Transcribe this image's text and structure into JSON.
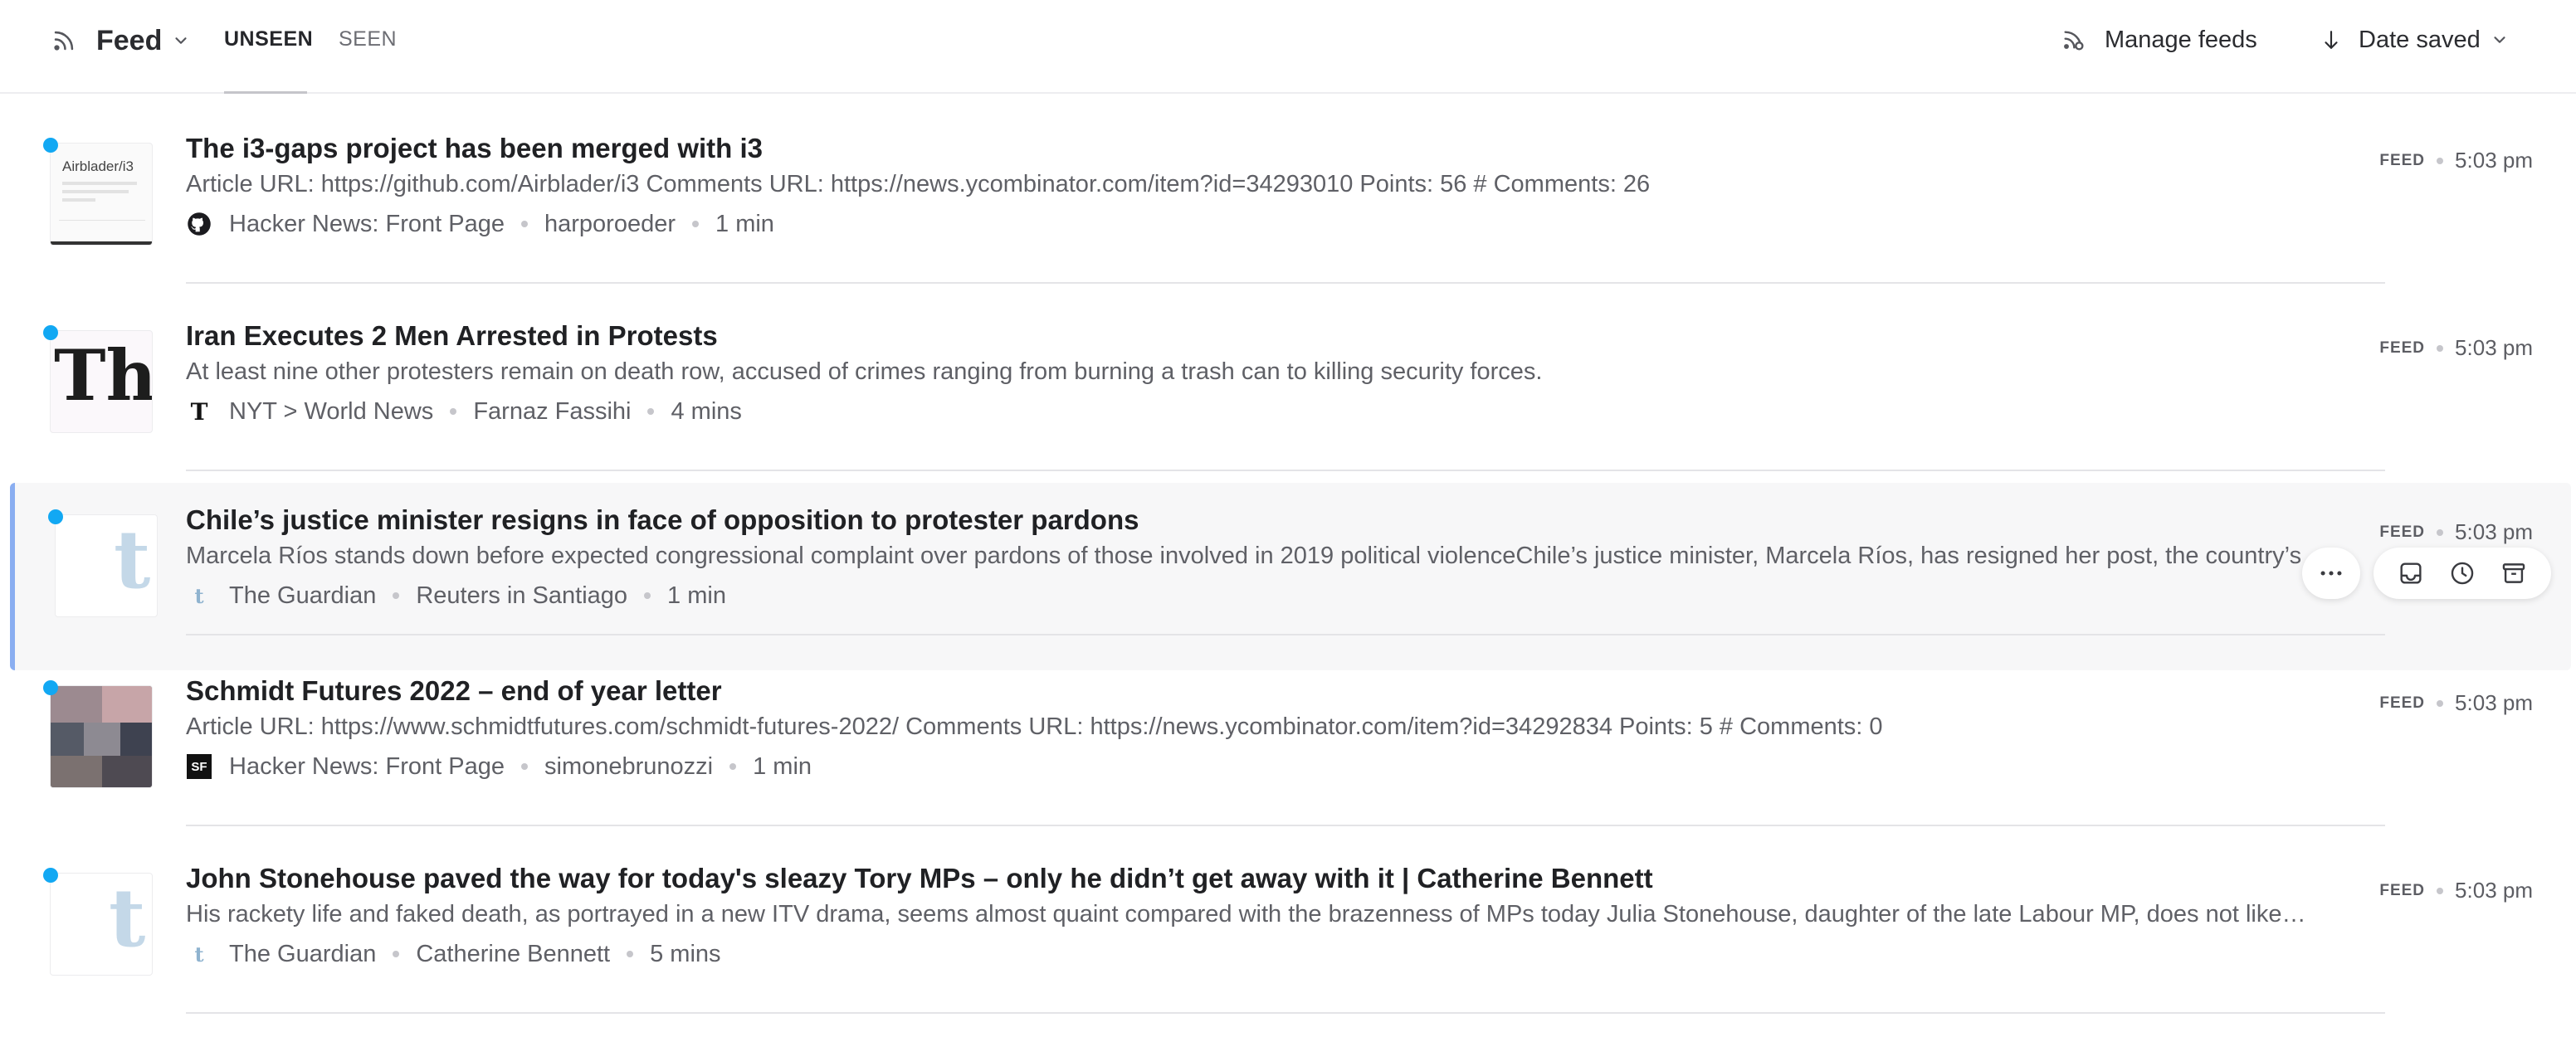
{
  "header": {
    "feed_label": "Feed",
    "tabs": [
      {
        "label": "UNSEEN",
        "active": true
      },
      {
        "label": "SEEN",
        "active": false
      }
    ],
    "manage_label": "Manage feeds",
    "sort_label": "Date saved"
  },
  "items": [
    {
      "title": "The i3-gaps project has been merged with i3",
      "description": "Article URL: https://github.com/Airblader/i3 Comments URL: https://news.ycombinator.com/item?id=34293010 Points: 56 # Comments: 26",
      "source": "Hacker News: Front Page",
      "author": "harporoeder",
      "read_time": "1 min",
      "badge": "FEED",
      "time": "5:03 pm",
      "thumb_text": "Airblader/i3",
      "icon": "github-icon",
      "unseen": true
    },
    {
      "title": "Iran Executes 2 Men Arrested in Protests",
      "description": "At least nine other protesters remain on death row, accused of crimes ranging from burning a trash can to killing security forces.",
      "source": "NYT > World News",
      "author": "Farnaz Fassihi",
      "read_time": "4 mins",
      "badge": "FEED",
      "time": "5:03 pm",
      "thumb_text": "The",
      "icon": "nyt-icon",
      "unseen": true
    },
    {
      "title": "Chile’s justice minister resigns in face of opposition to protester pardons",
      "description": "Marcela Ríos stands down before expected congressional complaint over pardons of those involved in 2019 political violenceChile’s justice minister, Marcela Ríos, has resigned her post, the country’s",
      "source": "The Guardian",
      "author": "Reuters in Santiago",
      "read_time": "1 min",
      "badge": "FEED",
      "time": "5:03 pm",
      "thumb_text": "t",
      "icon": "guardian-icon",
      "unseen": true
    },
    {
      "title": "Schmidt Futures 2022 – end of year letter",
      "description": "Article URL: https://www.schmidtfutures.com/schmidt-futures-2022/ Comments URL: https://news.ycombinator.com/item?id=34292834 Points: 5 # Comments: 0",
      "source": "Hacker News: Front Page",
      "author": "simonebrunozzi",
      "read_time": "1 min",
      "badge": "FEED",
      "time": "5:03 pm",
      "thumb_text": "",
      "icon": "sf-icon",
      "icon_text": "SF",
      "unseen": true
    },
    {
      "title": "John Stonehouse paved the way for today's sleazy Tory MPs – only he didn’t get away with it | Catherine Bennett",
      "description": "His rackety life and faked death, as portrayed in a new ITV drama, seems almost quaint compared with the brazenness of MPs today Julia Stonehouse, daughter of the late Labour MP, does not like…",
      "source": "The Guardian",
      "author": "Catherine Bennett",
      "read_time": "5 mins",
      "badge": "FEED",
      "time": "5:03 pm",
      "thumb_text": "t",
      "icon": "guardian-icon",
      "unseen": true
    }
  ],
  "colors": {
    "unseen_dot": "#12a8f3",
    "hover_border": "#8aaef1",
    "hover_bg": "#f7f7f8"
  }
}
